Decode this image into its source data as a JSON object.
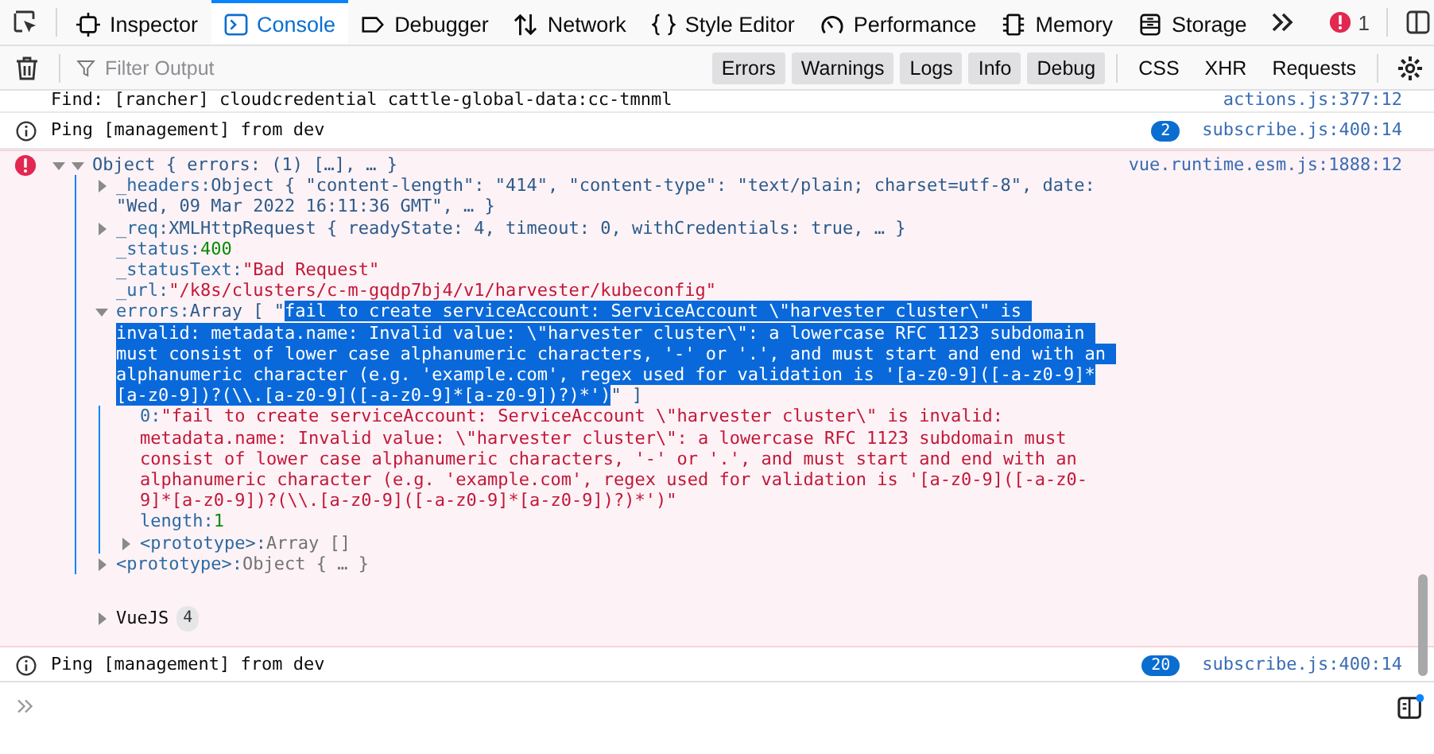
{
  "toolbar": {
    "tabs": [
      {
        "label": "Inspector",
        "selected": false
      },
      {
        "label": "Console",
        "selected": true
      },
      {
        "label": "Debugger",
        "selected": false
      },
      {
        "label": "Network",
        "selected": false
      },
      {
        "label": "Style Editor",
        "selected": false
      },
      {
        "label": "Performance",
        "selected": false
      },
      {
        "label": "Memory",
        "selected": false
      },
      {
        "label": "Storage",
        "selected": false
      }
    ],
    "error_count": "1"
  },
  "filter_bar": {
    "placeholder": "Filter Output",
    "levels": [
      {
        "label": "Errors",
        "on": true
      },
      {
        "label": "Warnings",
        "on": true
      },
      {
        "label": "Logs",
        "on": true
      },
      {
        "label": "Info",
        "on": true
      },
      {
        "label": "Debug",
        "on": true
      }
    ],
    "requests": [
      {
        "label": "CSS",
        "on": false
      },
      {
        "label": "XHR",
        "on": false
      },
      {
        "label": "Requests",
        "on": false
      }
    ]
  },
  "messages": [
    {
      "kind": "log",
      "text": "Find: [rancher] cloudcredential cattle-global-data:cc-tmnml",
      "source": "actions.js:377:12"
    },
    {
      "kind": "info",
      "text": "Ping [management] from dev",
      "count": "2",
      "source": "subscribe.js:400:14"
    },
    {
      "kind": "error",
      "expanded": true,
      "source": "vue.runtime.esm.js:1888:12",
      "tree": {
        "value": "Object { errors: (1) […], … }",
        "kind": "object",
        "expanded": true,
        "children": [
          {
            "key": "_headers:",
            "value": "Object { \"content-length\": \"414\", \"content-type\": \"text/plain; charset=utf-8\", date: \"Wed, 09 Mar 2022 16:11:36 GMT\", … }",
            "kind": "object",
            "expanded": false
          },
          {
            "key": "_req:",
            "value": "XMLHttpRequest { readyState: 4, timeout: 0, withCredentials: true, … }",
            "kind": "object",
            "expanded": false
          },
          {
            "key": "_status:",
            "value": "400",
            "kind": "number"
          },
          {
            "key": "_statusText:",
            "value": "\"Bad Request\"",
            "kind": "string"
          },
          {
            "key": "_url:",
            "value": "\"/k8s/clusters/c-m-gqdp7bj4/v1/harvester/kubeconfig\"",
            "kind": "string"
          },
          {
            "key": "errors:",
            "value": "Array [ \"",
            "selected_text": "fail to create serviceAccount: ServiceAccount \\\"harvester cluster\\\" is invalid: metadata.name: Invalid value: \\\"harvester cluster\\\": a lowercase RFC 1123 subdomain must consist of lower case alphanumeric characters, '-' or '.', and must start and end with an alphanumeric character (e.g. 'example.com', regex used for validation is '[a-z0-9]([-a-z0-9]*[a-z0-9])?(\\\\.[a-z0-9]([-a-z0-9]*[a-z0-9])?)*')",
            "value_end": "\" ]",
            "kind": "object",
            "expanded": true,
            "children": [
              {
                "key": "0:",
                "value": "\"fail to create serviceAccount: ServiceAccount \\\"harvester cluster\\\" is invalid: metadata.name: Invalid value: \\\"harvester cluster\\\": a lowercase RFC 1123 subdomain must consist of lower case alphanumeric characters, '-' or '.', and must start and end with an alphanumeric character (e.g. 'example.com', regex used for validation is '[a-z0-9]([-a-z0-9]*[a-z0-9])?(\\\\.[a-z0-9]([-a-z0-9]*[a-z0-9])?)*')\"",
                "kind": "string"
              },
              {
                "key": "length:",
                "value": "1",
                "kind": "number"
              },
              {
                "key": "<prototype>:",
                "value": "Array []",
                "kind": "prototype",
                "expanded": false
              }
            ]
          },
          {
            "key": "<prototype>:",
            "value": "Object { … }",
            "kind": "prototype",
            "expanded": false
          }
        ]
      },
      "group": {
        "label": "VueJS",
        "count": "4",
        "expanded": false
      }
    },
    {
      "kind": "info",
      "text": "Ping [management] from dev",
      "count": "20",
      "source": "subscribe.js:400:14"
    }
  ]
}
